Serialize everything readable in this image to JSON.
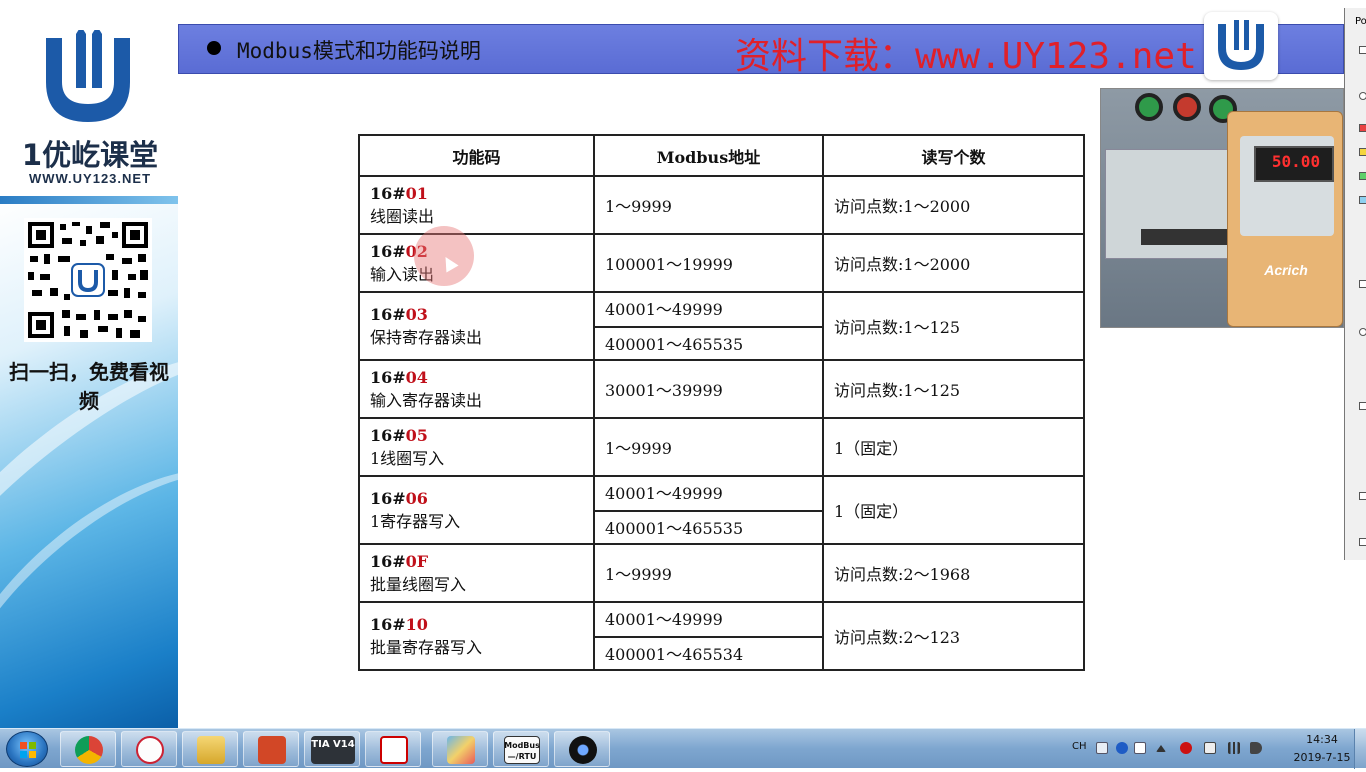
{
  "sidebar": {
    "brand_name": "1优屹课堂",
    "brand_url": "WWW.UY123.NET",
    "qr_caption": "扫一扫，免费看视频"
  },
  "header": {
    "title": "Modbus模式和功能码说明",
    "download": "资料下载：www.UY123.net"
  },
  "table": {
    "headers": [
      "功能码",
      "Modbus地址",
      "读写个数"
    ],
    "rows": [
      {
        "code_prefix": "16#",
        "code_num": "01",
        "desc": "线圈读出",
        "addresses": [
          "1～9999"
        ],
        "count": "访问点数:1～2000"
      },
      {
        "code_prefix": "16#",
        "code_num": "02",
        "desc": "输入读出",
        "addresses": [
          "100001～19999"
        ],
        "count": "访问点数:1～2000"
      },
      {
        "code_prefix": "16#",
        "code_num": "03",
        "desc": "保持寄存器读出",
        "addresses": [
          "40001～49999",
          "400001～465535"
        ],
        "count": "访问点数:1～125"
      },
      {
        "code_prefix": "16#",
        "code_num": "04",
        "desc": "输入寄存器读出",
        "addresses": [
          "30001～39999"
        ],
        "count": "访问点数:1～125"
      },
      {
        "code_prefix": "16#",
        "code_num": "05",
        "desc": "1线圈写入",
        "addresses": [
          "1～9999"
        ],
        "count": "1（固定）"
      },
      {
        "code_prefix": "16#",
        "code_num": "06",
        "desc": "1寄存器写入",
        "addresses": [
          "40001～49999",
          "400001～465535"
        ],
        "count": "1（固定）"
      },
      {
        "code_prefix": "16#",
        "code_num": "0F",
        "desc": "批量线圈写入",
        "addresses": [
          "1～9999"
        ],
        "count": "访问点数:2～1968"
      },
      {
        "code_prefix": "16#",
        "code_num": "10",
        "desc": "批量寄存器写入",
        "addresses": [
          "40001～49999",
          "400001～465534"
        ],
        "count": "访问点数:2～123"
      }
    ]
  },
  "video": {
    "inverter_display": "50.00",
    "inverter_brand": "Acrich"
  },
  "right_window": {
    "title": "Po"
  },
  "taskbar": {
    "apps": [
      {
        "name": "chrome-icon",
        "label": ""
      },
      {
        "name": "snipping-icon",
        "label": ""
      },
      {
        "name": "explorer-icon",
        "label": ""
      },
      {
        "name": "powerpoint-icon",
        "label": ""
      },
      {
        "name": "tia-portal-icon",
        "label": "TIA V14"
      },
      {
        "name": "pdf-icon",
        "label": ""
      },
      {
        "name": "paint-icon",
        "label": ""
      },
      {
        "name": "modbus-rtu-icon",
        "label": "ModBus —/RTU"
      },
      {
        "name": "camera-icon",
        "label": ""
      }
    ],
    "lang": "CH",
    "time": "14:34",
    "date": "2019-7-15"
  },
  "colors": {
    "header_bg": "#5a6cd4",
    "download_text": "#e0202a",
    "code_num": "#c0101a"
  }
}
